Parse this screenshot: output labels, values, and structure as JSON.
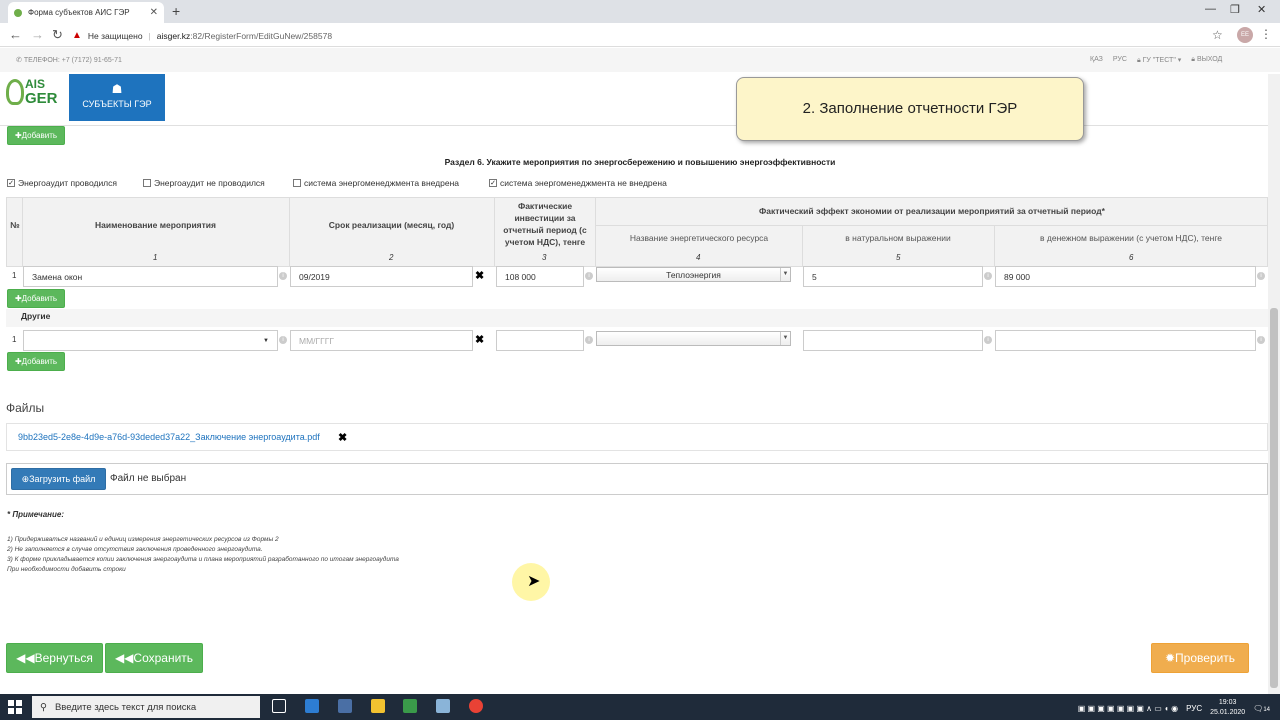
{
  "browser": {
    "tab_title": "Форма субъектов АИС ГЭР",
    "new_tab": "+",
    "tab_close": "✕",
    "security_label": "Не защищено",
    "url_host": "aisger.kz",
    "url_path": ":82/RegisterForm/EditGuNew/258578",
    "profile_initials": "ЕЕ",
    "win_min": "—",
    "win_max": "❐",
    "win_close": "✕"
  },
  "topbar": {
    "phone": "ТЕЛЕФОН: +7 (7172) 91-65-71",
    "lang_kz": "ҚАЗ",
    "lang_ru": "РУС",
    "user": "ГУ \"ТЕСТ\" ▾",
    "logout": "ВЫХОД"
  },
  "nav": {
    "logo_top": "AIS",
    "logo_bottom": "GER",
    "subjects": "СУБЪЕКТЫ ГЭР"
  },
  "banner": "2. Заполнение отчетности ГЭР",
  "add_label": "✚Добавить",
  "section_title": "Раздел 6. Укажите мероприятия по энергосбережению и повышению энергоэффективности",
  "checkboxes": [
    {
      "label": "Энергоаудит проводился",
      "checked": true
    },
    {
      "label": "Энергоаудит не проводился",
      "checked": false
    },
    {
      "label": "система энергоменеджмента внедрена",
      "checked": false
    },
    {
      "label": "система энергоменеджмента не внедрена",
      "checked": true
    }
  ],
  "table": {
    "h_no": "№",
    "h_name": "Наименование мероприятия",
    "h_period": "Срок реализации (месяц, год)",
    "h_invest": "Фактические инвестиции за отчетный период (с учетом НДС), тенге",
    "h_effect": "Фактический эффект экономии от реализации мероприятий за отчетный период*",
    "h_resource": "Название энергетического ресурса",
    "h_natural": "в натуральном выражении",
    "h_money": "в денежном выражении (с учетом НДС), тенге",
    "col_nums": [
      "1",
      "2",
      "3",
      "4",
      "5",
      "6"
    ],
    "row1": {
      "num": "1",
      "name": "Замена окон",
      "period": "09/2019",
      "invest": "108 000",
      "resource": "Теплоэнергия",
      "natural": "5",
      "money": "89 000"
    },
    "other_label": "Другие",
    "row2": {
      "num": "1",
      "period_placeholder": "ММ/ГГГГ"
    }
  },
  "files": {
    "title": "Файлы",
    "file_name": "9bb23ed5-2e8e-4d9e-a76d-93deded37a22_Заключение энергоаудита.pdf",
    "upload": "Загрузить файл",
    "no_file": "Файл не выбран"
  },
  "notes": {
    "title": "* Примечание:",
    "lines": [
      "1) Придерживаться названий и единиц измерения энергетических ресурсов из Формы 2",
      "2) Не заполняется в случае отсутствия заключения проведенного энергоаудита.",
      "3) К форме прикладывается копии заключения энергоаудита и плана мероприятий разработанного по итогам энергоаудита",
      "При необходимости добавить строки"
    ]
  },
  "actions": {
    "back": "Вернуться",
    "save": "Сохранить",
    "check": "Проверить"
  },
  "taskbar": {
    "search_placeholder": "Введите здесь текст для поиска",
    "lang": "РУС",
    "time": "19:03",
    "date": "25.01.2020",
    "notif": "14"
  },
  "colors": {
    "green": "#5cb85c",
    "blue": "#337ab7",
    "orange": "#f0ad4e",
    "banner": "#fdf5c9"
  }
}
